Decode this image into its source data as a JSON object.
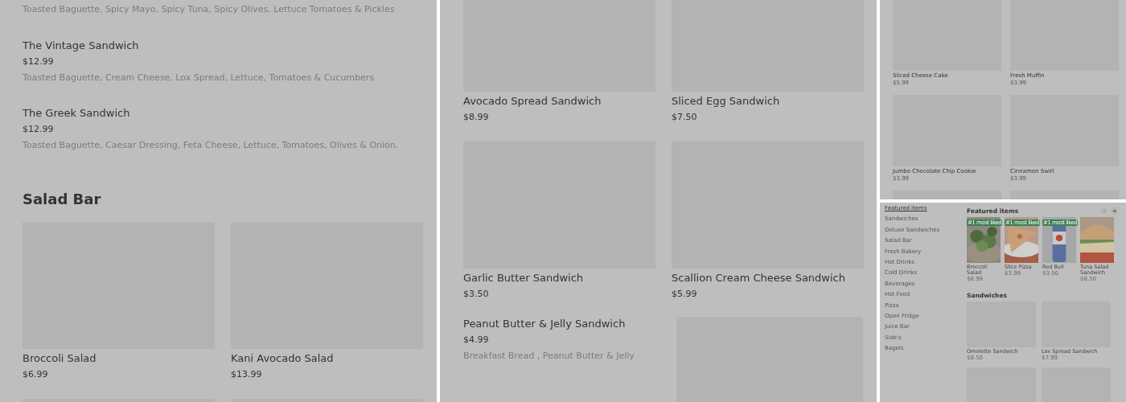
{
  "menu_panel": {
    "partial_description": "Toasted Baguette, Spicy Mayo, Spicy Tuna, Spicy Olives, Lettuce Tomatoes & Pickles",
    "items": [
      {
        "name": "The Vintage Sandwich",
        "price": "$12.99",
        "description": "Toasted Baguette, Cream Cheese, Lox Spread, Lettuce, Tomatoes & Cucumbers"
      },
      {
        "name": "The Greek Sandwich",
        "price": "$12.99",
        "description": "Toasted Baguette, Caesar Dressing, Feta Cheese, Lettuce, Tomatoes, Olives & Onion."
      }
    ],
    "section_title": "Salad Bar",
    "cards": [
      {
        "name": "Broccoli Salad",
        "price": "$6.99"
      },
      {
        "name": "Kani Avocado Salad",
        "price": "$13.99"
      }
    ]
  },
  "sandwich_panel": {
    "cards": [
      {
        "name": "Avocado Spread Sandwich",
        "price": "$8.99"
      },
      {
        "name": "Sliced Egg Sandwich",
        "price": "$7.50"
      },
      {
        "name": "Garlic Butter Sandwich",
        "price": "$3.50"
      },
      {
        "name": "Scallion Cream Cheese Sandwich",
        "price": "$5.99"
      }
    ],
    "list_item": {
      "name": "Peanut Butter & Jelly Sandwich",
      "price": "$4.99",
      "description": "Breakfast Bread , Peanut Butter & Jelly"
    }
  },
  "bakery_panel": {
    "cards": [
      {
        "name": "Sliced Cheese Cake",
        "price": "$5.99"
      },
      {
        "name": "Fresh Muffin",
        "price": "$3.99"
      },
      {
        "name": "Jumbo Chocolate Chip Cookie",
        "price": "$3.99"
      },
      {
        "name": "Cinnamon Swirl",
        "price": "$3.99"
      }
    ]
  },
  "store_panel": {
    "sidebar": [
      {
        "label": "Featured items",
        "selected": true
      },
      {
        "label": "Sandwiches",
        "selected": false
      },
      {
        "label": "Deluxe Sandwiches",
        "selected": false
      },
      {
        "label": "Salad Bar",
        "selected": false
      },
      {
        "label": "Fresh Bakery",
        "selected": false
      },
      {
        "label": "Hot Drinks",
        "selected": false
      },
      {
        "label": "Cold Drinks",
        "selected": false
      },
      {
        "label": "Beverages",
        "selected": false
      },
      {
        "label": "Hot Food",
        "selected": false
      },
      {
        "label": "Pizza",
        "selected": false
      },
      {
        "label": "Open Fridge",
        "selected": false
      },
      {
        "label": "Juice Bar",
        "selected": false
      },
      {
        "label": "Side's",
        "selected": false
      },
      {
        "label": "Bagels",
        "selected": false
      }
    ],
    "featured_title": "Featured items",
    "carousel": {
      "previous_disabled": true,
      "next_disabled": false
    },
    "featured": [
      {
        "badge": "#1 most liked",
        "name": "Broccoli Salad",
        "price": "$6.99"
      },
      {
        "badge": "#1 most liked",
        "name": "Slice Pizza",
        "price": "$3.99"
      },
      {
        "badge": "#1 most liked",
        "name": "Red Bull",
        "price": "$3.50"
      },
      {
        "name": "Tuna Salad Sandwich",
        "price": "$8.50"
      }
    ],
    "section_title": "Sandwiches",
    "cards": [
      {
        "name": "Omelette Sandwich",
        "price": "$8.50"
      },
      {
        "name": "Lox Spread Sandwich",
        "price": "$7.99"
      }
    ]
  }
}
